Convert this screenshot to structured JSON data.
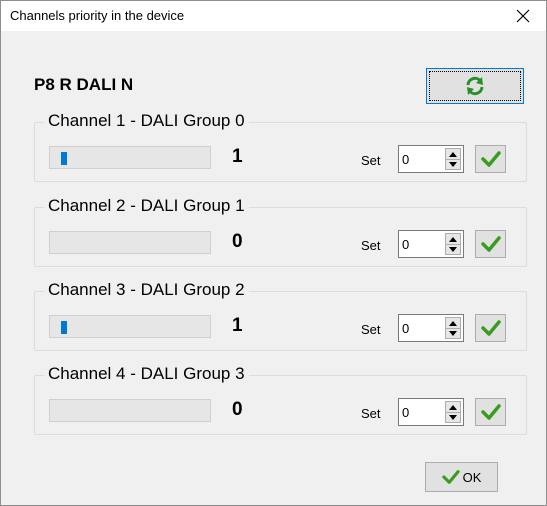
{
  "window": {
    "title": "Channels priority in the device",
    "close_glyph": "✕"
  },
  "device": {
    "name": "P8 R DALI N",
    "refresh_icon": "refresh-icon"
  },
  "channels": [
    {
      "label": "Channel 1 - DALI Group 0",
      "value": "1",
      "level": 1,
      "set_label": "Set",
      "set_value": "0"
    },
    {
      "label": "Channel 2 - DALI Group 1",
      "value": "0",
      "level": 0,
      "set_label": "Set",
      "set_value": "0"
    },
    {
      "label": "Channel 3 - DALI Group 2",
      "value": "1",
      "level": 1,
      "set_label": "Set",
      "set_value": "0"
    },
    {
      "label": "Channel 4 - DALI Group 3",
      "value": "0",
      "level": 0,
      "set_label": "Set",
      "set_value": "0"
    }
  ],
  "ok_button": {
    "label": "OK"
  },
  "colors": {
    "accent": "#0078d7",
    "check_green": "#3a9c1f",
    "refresh_green": "#2a8f2a"
  }
}
